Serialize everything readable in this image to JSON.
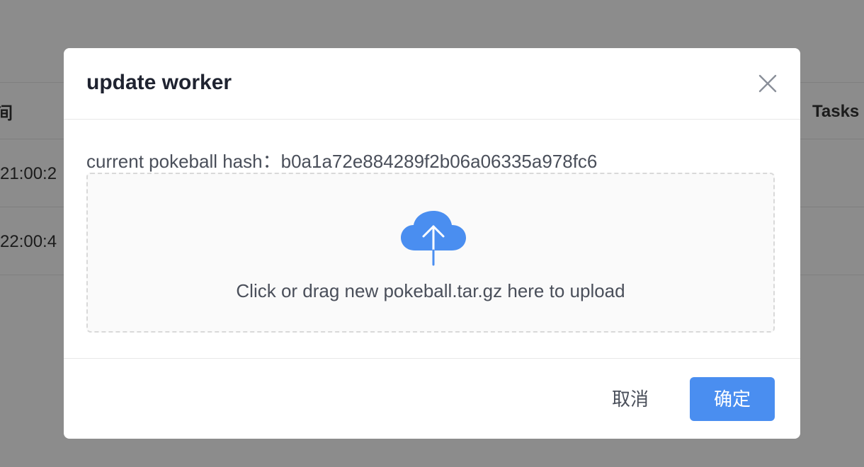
{
  "background": {
    "left_header": "间",
    "right_header": "Tasks",
    "rows": [
      "21:00:2",
      "22:00:4"
    ]
  },
  "modal": {
    "title": "update worker",
    "hash_label": "current pokeball hash：",
    "hash_value": "b0a1a72e884289f2b06a06335a978fc6",
    "upload_text": "Click or drag new pokeball.tar.gz here to upload",
    "cancel_label": "取消",
    "ok_label": "确定",
    "icons": {
      "close": "close-icon",
      "upload": "cloud-upload-icon"
    }
  },
  "colors": {
    "primary": "#4a8ef0",
    "overlay": "rgba(0,0,0,0.45)",
    "icon": "#4a8ef0"
  }
}
